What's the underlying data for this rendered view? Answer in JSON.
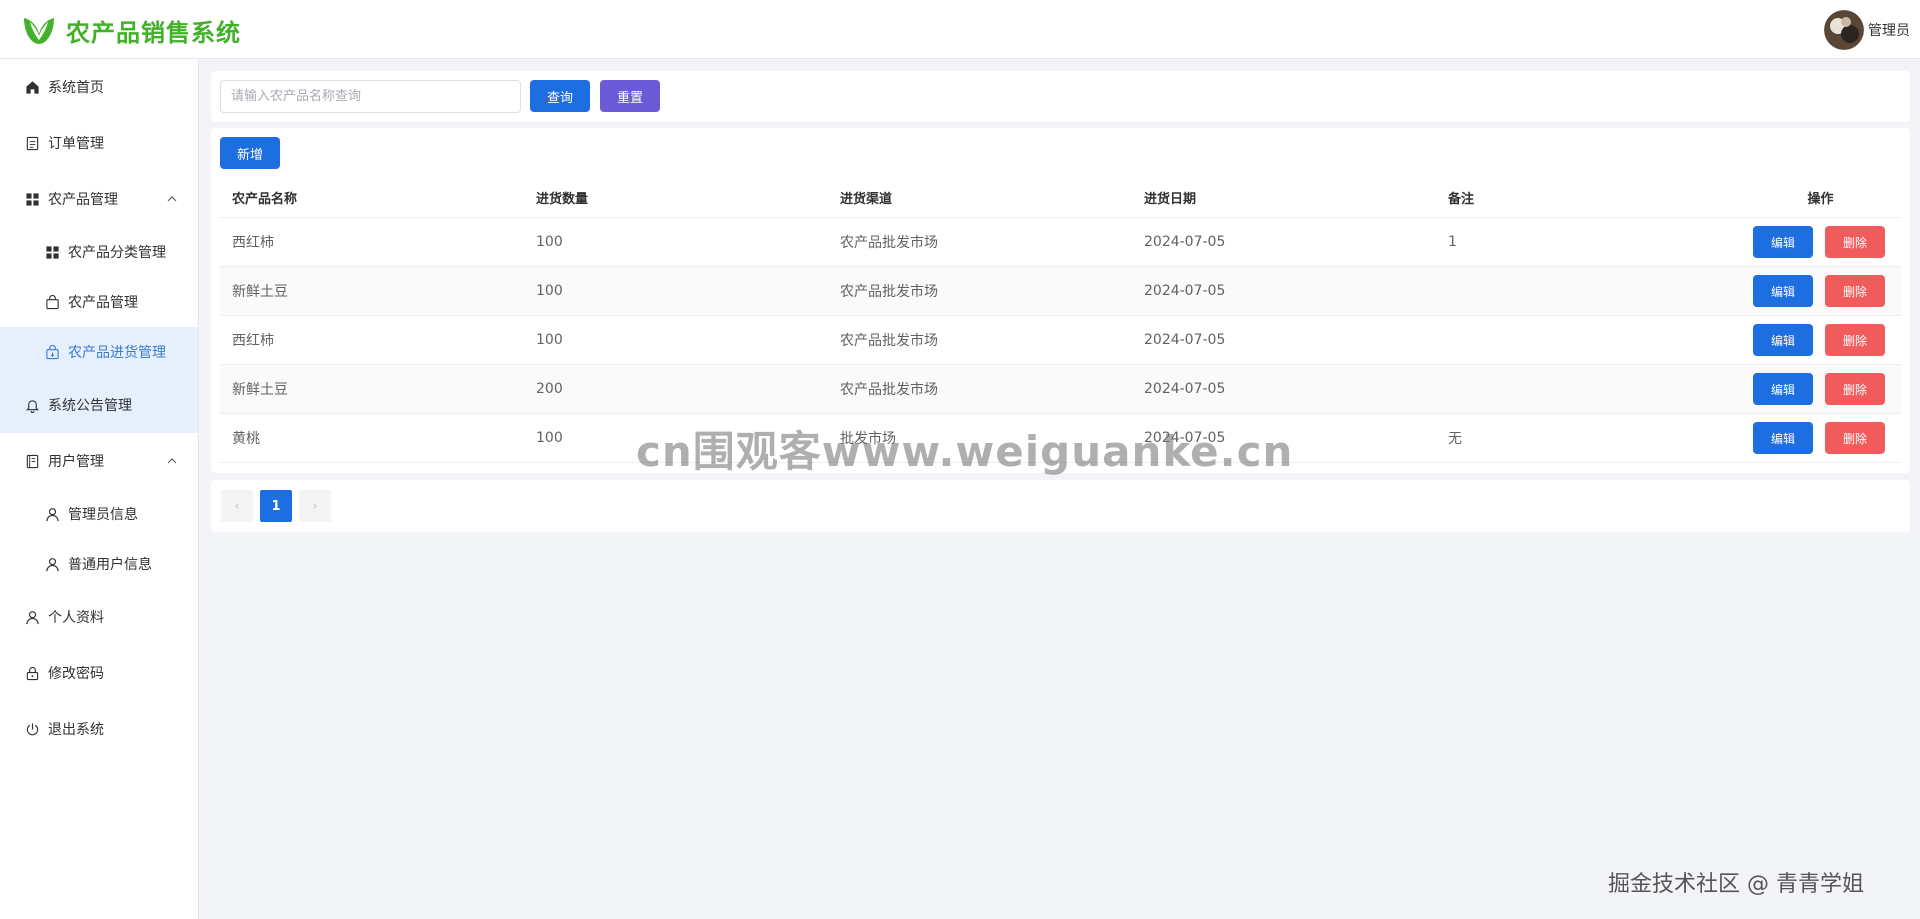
{
  "header": {
    "app_title": "农产品销售系统",
    "user_name": "管理员",
    "brand_color": "#43b02a"
  },
  "sidebar": {
    "items": [
      {
        "label": "系统首页",
        "icon": "home-icon"
      },
      {
        "label": "订单管理",
        "icon": "document-icon"
      },
      {
        "label": "农产品管理",
        "icon": "grid-icon",
        "expanded": true,
        "children": [
          {
            "label": "农产品分类管理",
            "icon": "grid-icon"
          },
          {
            "label": "农产品管理",
            "icon": "bag-icon"
          },
          {
            "label": "农产品进货管理",
            "icon": "bag-arrow-icon",
            "active": true
          }
        ]
      },
      {
        "label": "系统公告管理",
        "icon": "bell-icon",
        "highlighted": true
      },
      {
        "label": "用户管理",
        "icon": "notebook-icon",
        "expanded": true,
        "children": [
          {
            "label": "管理员信息",
            "icon": "user-icon"
          },
          {
            "label": "普通用户信息",
            "icon": "user-icon"
          }
        ]
      },
      {
        "label": "个人资料",
        "icon": "user-icon"
      },
      {
        "label": "修改密码",
        "icon": "lock-icon"
      },
      {
        "label": "退出系统",
        "icon": "power-icon"
      }
    ]
  },
  "search": {
    "placeholder": "请输入农产品名称查询",
    "value": "",
    "query_label": "查询",
    "reset_label": "重置"
  },
  "toolbar": {
    "add_label": "新增"
  },
  "table": {
    "columns": [
      "农产品名称",
      "进货数量",
      "进货渠道",
      "进货日期",
      "备注",
      "操作"
    ],
    "rows": [
      {
        "name": "西红柿",
        "quantity": "100",
        "channel": "农产品批发市场",
        "date": "2024-07-05",
        "note": "1"
      },
      {
        "name": "新鲜土豆",
        "quantity": "100",
        "channel": "农产品批发市场",
        "date": "2024-07-05",
        "note": ""
      },
      {
        "name": "西红柿",
        "quantity": "100",
        "channel": "农产品批发市场",
        "date": "2024-07-05",
        "note": ""
      },
      {
        "name": "新鲜土豆",
        "quantity": "200",
        "channel": "农产品批发市场",
        "date": "2024-07-05",
        "note": ""
      },
      {
        "name": "黄桃",
        "quantity": "100",
        "channel": "批发市场",
        "date": "2024-07-05",
        "note": "无"
      }
    ],
    "edit_label": "编辑",
    "delete_label": "删除"
  },
  "pagination": {
    "current_page": "1",
    "prev": "‹",
    "next": "›"
  },
  "watermarks": {
    "center": "cn围观客www.weiguanke.cn",
    "bottom": "掘金技术社区 @ 青青学姐"
  },
  "colors": {
    "primary": "#1d6ee0",
    "reset": "#6b5bd6",
    "danger": "#f25b5b",
    "active_bg": "#e6f0fc"
  }
}
